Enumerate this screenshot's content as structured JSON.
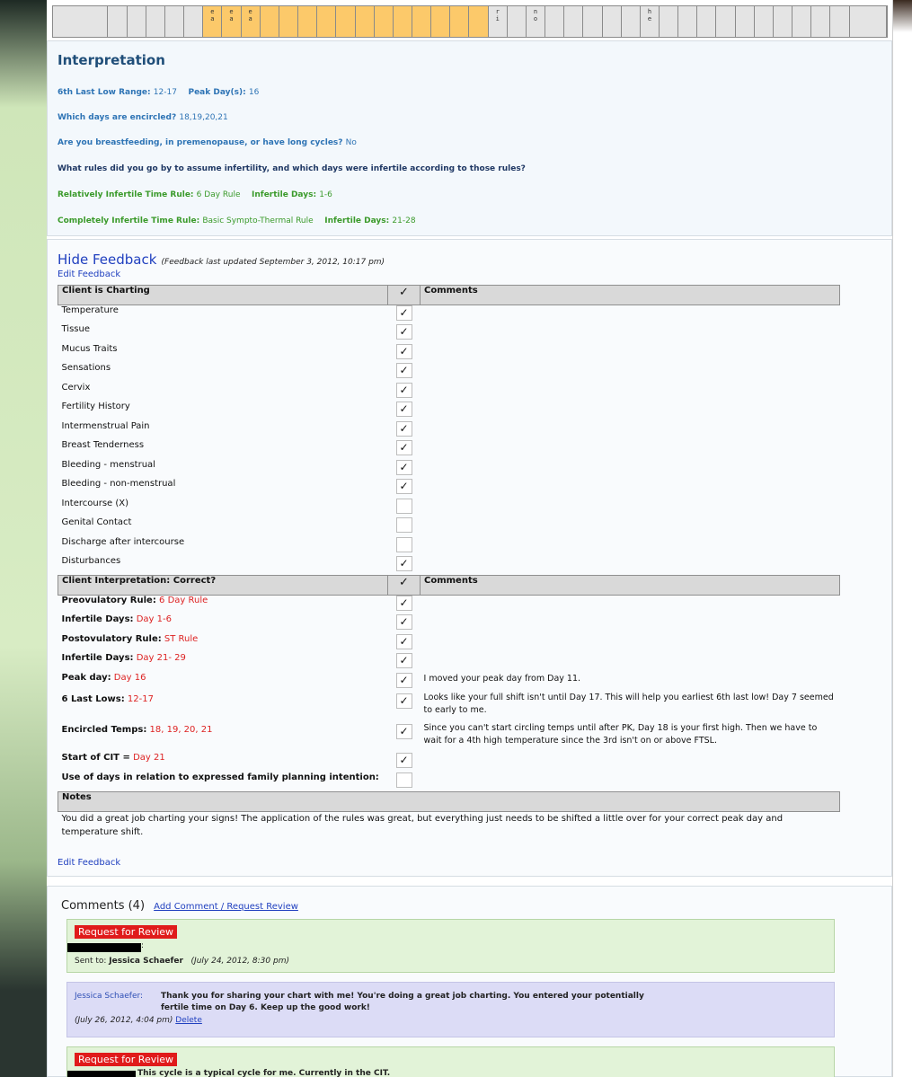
{
  "chart_strip": {
    "cells": [
      {
        "hi": false,
        "l1": "",
        "l2": ""
      },
      {
        "hi": false,
        "l1": "",
        "l2": ""
      },
      {
        "hi": false,
        "l1": "",
        "l2": ""
      },
      {
        "hi": false,
        "l1": "",
        "l2": ""
      },
      {
        "hi": false,
        "l1": "",
        "l2": ""
      },
      {
        "hi": false,
        "l1": "",
        "l2": ""
      },
      {
        "hi": true,
        "l1": "e",
        "l2": "a"
      },
      {
        "hi": true,
        "l1": "e",
        "l2": "a"
      },
      {
        "hi": true,
        "l1": "e",
        "l2": "a"
      },
      {
        "hi": true,
        "l1": "",
        "l2": ""
      },
      {
        "hi": true,
        "l1": "",
        "l2": ""
      },
      {
        "hi": true,
        "l1": "",
        "l2": ""
      },
      {
        "hi": true,
        "l1": "",
        "l2": ""
      },
      {
        "hi": true,
        "l1": "",
        "l2": ""
      },
      {
        "hi": true,
        "l1": "",
        "l2": ""
      },
      {
        "hi": true,
        "l1": "",
        "l2": ""
      },
      {
        "hi": true,
        "l1": "",
        "l2": ""
      },
      {
        "hi": true,
        "l1": "",
        "l2": ""
      },
      {
        "hi": true,
        "l1": "",
        "l2": ""
      },
      {
        "hi": true,
        "l1": "",
        "l2": ""
      },
      {
        "hi": true,
        "l1": "",
        "l2": ""
      },
      {
        "hi": false,
        "l1": "r",
        "l2": "i"
      },
      {
        "hi": false,
        "l1": "",
        "l2": ""
      },
      {
        "hi": false,
        "l1": "n",
        "l2": "o"
      },
      {
        "hi": false,
        "l1": "",
        "l2": ""
      },
      {
        "hi": false,
        "l1": "",
        "l2": ""
      },
      {
        "hi": false,
        "l1": "",
        "l2": ""
      },
      {
        "hi": false,
        "l1": "",
        "l2": ""
      },
      {
        "hi": false,
        "l1": "",
        "l2": ""
      },
      {
        "hi": false,
        "l1": "h",
        "l2": "e"
      },
      {
        "hi": false,
        "l1": "",
        "l2": ""
      },
      {
        "hi": false,
        "l1": "",
        "l2": ""
      },
      {
        "hi": false,
        "l1": "",
        "l2": ""
      },
      {
        "hi": false,
        "l1": "",
        "l2": ""
      },
      {
        "hi": false,
        "l1": "",
        "l2": ""
      },
      {
        "hi": false,
        "l1": "",
        "l2": ""
      },
      {
        "hi": false,
        "l1": "",
        "l2": ""
      },
      {
        "hi": false,
        "l1": "",
        "l2": ""
      },
      {
        "hi": false,
        "l1": "",
        "l2": ""
      },
      {
        "hi": false,
        "l1": "",
        "l2": ""
      },
      {
        "hi": false,
        "l1": "",
        "l2": ""
      }
    ]
  },
  "interpretation": {
    "title": "Interpretation",
    "low_range_label": "6th Last Low Range:",
    "low_range_value": "12-17",
    "peak_label": "Peak Day(s):",
    "peak_value": "16",
    "encircled_label": "Which days are encircled?",
    "encircled_value": "18,19,20,21",
    "breastfeeding_label": "Are you breastfeeding, in premenopause, or have long cycles?",
    "breastfeeding_value": "No",
    "rules_question": "What rules did you go by to assume infertility, and which days were infertile according to those rules?",
    "rel_rule_label": "Relatively Infertile Time Rule:",
    "rel_rule_value": "6 Day Rule",
    "rel_days_label": "Infertile Days:",
    "rel_days_value": "1-6",
    "comp_rule_label": "Completely Infertile Time Rule:",
    "comp_rule_value": "Basic Sympto-Thermal Rule",
    "comp_days_label": "Infertile Days:",
    "comp_days_value": "21-28"
  },
  "feedback": {
    "hide_link": "Hide Feedback",
    "updated_note": "(Feedback last updated September 3, 2012, 10:17 pm)",
    "edit_link": "Edit Feedback",
    "check_header": "✓",
    "comments_header": "Comments",
    "charting_header": "Client is Charting",
    "charting_rows": [
      {
        "label": "Temperature",
        "check": "✓"
      },
      {
        "label": "Tissue",
        "check": "✓"
      },
      {
        "label": "Mucus Traits",
        "check": "✓"
      },
      {
        "label": "Sensations",
        "check": "✓"
      },
      {
        "label": "Cervix",
        "check": "✓"
      },
      {
        "label": "Fertility History",
        "check": "✓"
      },
      {
        "label": "Intermenstrual Pain",
        "check": "✓"
      },
      {
        "label": "Breast Tenderness",
        "check": "✓"
      },
      {
        "label": "Bleeding - menstrual",
        "check": "✓"
      },
      {
        "label": "Bleeding - non-menstrual",
        "check": "✓"
      },
      {
        "label": "Intercourse (X)",
        "check": ""
      },
      {
        "label": "Genital Contact",
        "check": ""
      },
      {
        "label": "Discharge after intercourse",
        "check": ""
      },
      {
        "label": "Disturbances",
        "check": "✓"
      }
    ],
    "interp_header": "Client Interpretation: Correct?",
    "interp_rows": [
      {
        "label": "Preovulatory Rule:",
        "value": "6 Day Rule",
        "check": "✓",
        "comment": ""
      },
      {
        "label": "Infertile Days:",
        "value": "Day 1-6",
        "check": "✓",
        "comment": ""
      },
      {
        "label": "Postovulatory Rule:",
        "value": "ST Rule",
        "check": "✓",
        "comment": ""
      },
      {
        "label": "Infertile Days:",
        "value": "Day 21- 29",
        "check": "✓",
        "comment": ""
      },
      {
        "label": "Peak day:",
        "value": "Day 16",
        "check": "✓",
        "comment": "I moved your peak day from Day 11."
      },
      {
        "label": "6 Last Lows:",
        "value": "12-17",
        "check": "✓",
        "comment": "Looks like your full shift isn't until Day 17. This will help you earliest 6th last low! Day 7 seemed to early to me."
      },
      {
        "label": "Encircled Temps:",
        "value": "18, 19, 20, 21",
        "check": "✓",
        "comment": "Since you can't start circling temps until after PK, Day 18 is your first high. Then we have to wait for a 4th high temperature since the 3rd isn't on or above FTSL."
      },
      {
        "label": "Start of CIT =",
        "value": "Day 21",
        "check": "✓",
        "comment": ""
      },
      {
        "label": "Use of days in relation to expressed family planning intention:",
        "value": "",
        "check": "",
        "comment": ""
      }
    ],
    "notes_header": "Notes",
    "notes_text": "You did a great job charting your signs! The application of the rules was great, but everything just needs to be shifted a little over for your correct peak day and temperature shift.",
    "edit_link_bottom": "Edit Feedback"
  },
  "comments": {
    "title": "Comments (4)",
    "add_link": "Add Comment / Request Review",
    "c1": {
      "badge": "Request for Review",
      "colon": ":",
      "sent_label": "Sent to:",
      "sent_name": "Jessica Schaefer",
      "time": "(July 24, 2012, 8:30 pm)"
    },
    "c2": {
      "author": "Jessica Schaefer:",
      "text1": "Thank you for sharing your chart with me! You're doing a great job charting. You entered your potentially",
      "text2": "fertile time on Day 6. Keep up the good work!",
      "time": "(July 26, 2012, 4:04 pm)",
      "delete": "Delete"
    },
    "c3": {
      "badge": "Request for Review",
      "text": "This cycle is a typical cycle for me. Currently in the CIT."
    }
  }
}
